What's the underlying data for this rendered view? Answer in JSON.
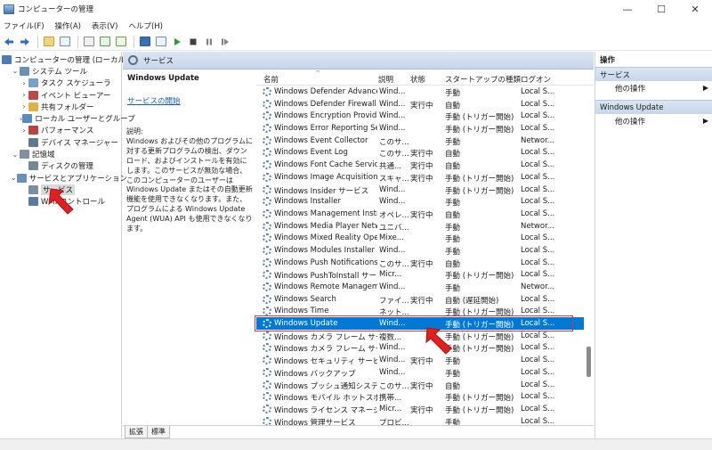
{
  "window": {
    "title": "コンピューターの管理",
    "controls": [
      "—",
      "☐",
      "✕"
    ]
  },
  "menu": [
    "ファイル(F)",
    "操作(A)",
    "表示(V)",
    "ヘルプ(H)"
  ],
  "tree": [
    {
      "label": "コンピューターの管理 (ローカル)",
      "indent": 0,
      "chev": "",
      "icon": "#4a7db5"
    },
    {
      "label": "システム ツール",
      "indent": 1,
      "chev": "⌄",
      "icon": "#6a8fb8"
    },
    {
      "label": "タスク スケジューラ",
      "indent": 2,
      "chev": "›",
      "icon": "#7aa0c8"
    },
    {
      "label": "イベント ビューアー",
      "indent": 2,
      "chev": "›",
      "icon": "#b94a48"
    },
    {
      "label": "共有フォルダー",
      "indent": 2,
      "chev": "›",
      "icon": "#e0b040"
    },
    {
      "label": "ローカル ユーザーとグループ",
      "indent": 2,
      "chev": "›",
      "icon": "#5a8ac0"
    },
    {
      "label": "パフォーマンス",
      "indent": 2,
      "chev": "›",
      "icon": "#c04040"
    },
    {
      "label": "デバイス マネージャー",
      "indent": 2,
      "chev": "",
      "icon": "#607890"
    },
    {
      "label": "記憶域",
      "indent": 1,
      "chev": "⌄",
      "icon": "#8090a0"
    },
    {
      "label": "ディスクの管理",
      "indent": 2,
      "chev": "",
      "icon": "#708898"
    },
    {
      "label": "サービスとアプリケーション",
      "indent": 1,
      "chev": "⌄",
      "icon": "#6a8fb8"
    },
    {
      "label": "サービス",
      "indent": 2,
      "chev": "",
      "icon": "#7d8fa3",
      "selected": true
    },
    {
      "label": "WMI コントロール",
      "indent": 2,
      "chev": "",
      "icon": "#5a7aa0"
    }
  ],
  "services_header": "サービス",
  "description": {
    "title": "Windows Update",
    "start_link": "サービスの開始",
    "text_label": "説明:",
    "text": "Windows およびその他のプログラムに対する更新プログラムの検出、ダウンロード、およびインストールを有効にします。このサービスが無効な場合、このコンピューターのユーザーは Windows Update またはその自動更新機能を使用できなくなります。また、プログラムによる Windows Update Agent (WUA) API も使用できなくなります。"
  },
  "columns": {
    "name": "名前",
    "description": "説明",
    "status": "状態",
    "startup": "スタートアップの種類",
    "logon": "ログオン"
  },
  "services": [
    {
      "name": "Windows Defender Advance...",
      "desc": "Wind...",
      "status": "",
      "startup": "手動",
      "logon": "Local S..."
    },
    {
      "name": "Windows Defender Firewall",
      "desc": "Wind...",
      "status": "実行中",
      "startup": "自動",
      "logon": "Local S..."
    },
    {
      "name": "Windows Encryption Provid...",
      "desc": "Wind...",
      "status": "",
      "startup": "手動 (トリガー開始)",
      "logon": "Local S..."
    },
    {
      "name": "Windows Error Reporting Se...",
      "desc": "Wind...",
      "status": "",
      "startup": "手動 (トリガー開始)",
      "logon": "Local S..."
    },
    {
      "name": "Windows Event Collector",
      "desc": "このサ...",
      "status": "",
      "startup": "手動",
      "logon": "Networ..."
    },
    {
      "name": "Windows Event Log",
      "desc": "このサ...",
      "status": "実行中",
      "startup": "自動",
      "logon": "Local S..."
    },
    {
      "name": "Windows Font Cache Service",
      "desc": "共通...",
      "status": "実行中",
      "startup": "自動",
      "logon": "Local S..."
    },
    {
      "name": "Windows Image Acquisition ...",
      "desc": "スキャ...",
      "status": "実行中",
      "startup": "手動 (トリガー開始)",
      "logon": "Local S..."
    },
    {
      "name": "Windows Insider サービス",
      "desc": "Wind...",
      "status": "",
      "startup": "手動 (トリガー開始)",
      "logon": "Local S..."
    },
    {
      "name": "Windows Installer",
      "desc": "Wind...",
      "status": "",
      "startup": "手動",
      "logon": "Local S..."
    },
    {
      "name": "Windows Management Instr...",
      "desc": "オペレ...",
      "status": "実行中",
      "startup": "自動",
      "logon": "Local S..."
    },
    {
      "name": "Windows Media Player Netw...",
      "desc": "ユニバ...",
      "status": "",
      "startup": "手動",
      "logon": "Networ..."
    },
    {
      "name": "Windows Mixed Reality Ope...",
      "desc": "Mixe...",
      "status": "",
      "startup": "手動",
      "logon": "Local S..."
    },
    {
      "name": "Windows Modules Installer",
      "desc": "Wind...",
      "status": "",
      "startup": "手動",
      "logon": "Local S..."
    },
    {
      "name": "Windows Push Notifications ...",
      "desc": "このサ...",
      "status": "実行中",
      "startup": "自動",
      "logon": "Local S..."
    },
    {
      "name": "Windows PushToInstall サービス",
      "desc": "Micr...",
      "status": "",
      "startup": "手動 (トリガー開始)",
      "logon": "Local S..."
    },
    {
      "name": "Windows Remote Managem...",
      "desc": "Wind...",
      "status": "",
      "startup": "手動",
      "logon": "Networ..."
    },
    {
      "name": "Windows Search",
      "desc": "ファイ...",
      "status": "実行中",
      "startup": "自動 (遅延開始)",
      "logon": "Local S..."
    },
    {
      "name": "Windows Time",
      "desc": "ネット...",
      "status": "",
      "startup": "手動 (トリガー開始)",
      "logon": "Local S..."
    },
    {
      "name": "Windows Update",
      "desc": "Wind...",
      "status": "",
      "startup": "手動 (トリガー開始)",
      "logon": "Local S...",
      "selected": true
    },
    {
      "name": "Windows カメラ フレーム サーバー",
      "desc": "複数...",
      "status": "",
      "startup": "手動 (トリガー開始)",
      "logon": "Local S..."
    },
    {
      "name": "Windows カメラ フレーム サーバー...",
      "desc": "Wind...",
      "status": "",
      "startup": "手動 (トリガー開始)",
      "logon": "Local S..."
    },
    {
      "name": "Windows セキュリティ サービス",
      "desc": "Wind...",
      "status": "実行中",
      "startup": "手動",
      "logon": "Local S..."
    },
    {
      "name": "Windows バックアップ",
      "desc": "Wind...",
      "status": "",
      "startup": "手動",
      "logon": "Local S..."
    },
    {
      "name": "Windows プッシュ通知システム ...",
      "desc": "このサ...",
      "status": "実行中",
      "startup": "自動",
      "logon": "Local S..."
    },
    {
      "name": "Windows モバイル ホットスポッ...",
      "desc": "携帯...",
      "status": "",
      "startup": "手動 (トリガー開始)",
      "logon": "Local S..."
    },
    {
      "name": "Windows ライセンス マネージャー...",
      "desc": "Micr...",
      "status": "実行中",
      "startup": "手動 (トリガー開始)",
      "logon": "Local S..."
    },
    {
      "name": "Windows 管理サービス",
      "desc": "プロビ...",
      "status": "",
      "startup": "手動",
      "logon": "Local S..."
    }
  ],
  "tabs": [
    "拡張",
    "標準"
  ],
  "actions": {
    "header": "操作",
    "sections": [
      {
        "title": "サービス",
        "items": [
          "他の操作"
        ]
      },
      {
        "title": "Windows Update",
        "items": [
          "他の操作"
        ]
      }
    ]
  },
  "colors": {
    "selection": "#0078d4",
    "annotation_red": "#c53b3b",
    "link": "#1a5fb4"
  }
}
